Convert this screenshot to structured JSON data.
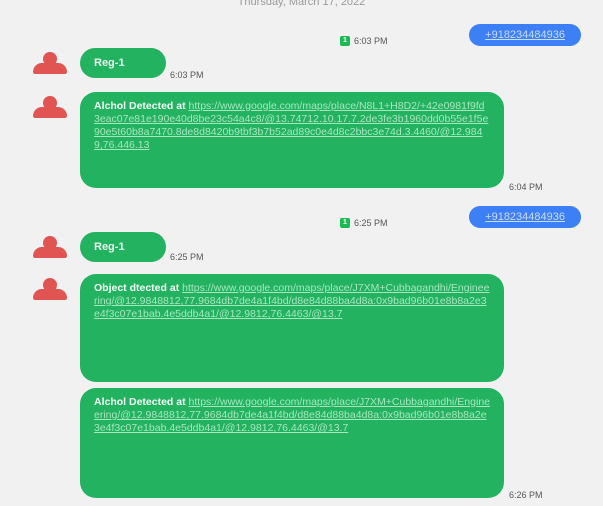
{
  "date_header": "Thursday, March 17, 2022",
  "messages": [
    {
      "sent": "+918234484936",
      "time": "6:03 PM"
    },
    {
      "text": "Reg-1",
      "time": "6:03 PM"
    },
    {
      "lead": "Alchol Detected at",
      "link": "https://www.google.com/maps/place/N8L1+H8D2/+42e0981f9fd3eac07e81e190e40d8be23c54a4c8/@13.74712.10.17.7.2de3fe3b1960dd0b55e1f5e90e5t60b8a7470.8de8d8420b9tbf3b7b52ad89c0e4d8c2bbc3e74d.3.4460/@12.9849,76.446.13",
      "time": "6:04 PM"
    },
    {
      "sent": "+918234484936",
      "time": "6:25 PM"
    },
    {
      "text": "Reg-1",
      "time": "6:25 PM"
    },
    {
      "lead": "Object dtected at",
      "link": "https://www.google.com/maps/place/J7XM+Cubbagandhi/Engineering/@12.9848812,77.9684db7de4a1f4bd/d8e84d88ba4d8a:0x9bad96b01e8b8a2e3e4f3c07e1bab.4e5ddb4a1/@12.9812,76.4463/@13.7",
      "time": ""
    },
    {
      "lead": "Alchol Detected at",
      "link": "https://www.google.com/maps/place/J7XM+Cubbagandhi/Engineering/@12.9848812,77.9684db7de4a1f4bd/d8e84d88ba4d8a:0x9bad96b01e8b8a2e3e4f3c07e1bab.4e5ddb4a1/@12.9812,76.4463/@13.7",
      "time": "6:26 PM"
    }
  ],
  "colors": {
    "background": "#f1f1f1",
    "sent_bubble": "#3d7ff5",
    "received_bubble": "#22b260",
    "avatar": "#e05552"
  },
  "icons": {
    "avatar": "person-avatar-icon",
    "sim": "sim-indicator-icon"
  }
}
